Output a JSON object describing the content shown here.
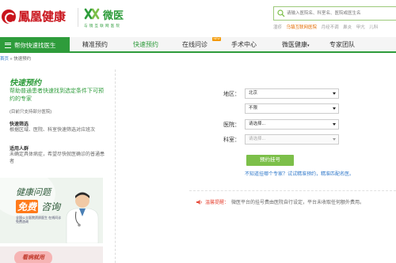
{
  "header": {
    "brand_fh": "鳳凰健康",
    "brand_wy": "微医",
    "brand_wy_sub": "与 镜 互 联 网 医 院",
    "search_placeholder": "请输入医院名、科室名、医院或医生名",
    "hot_items": [
      {
        "text": "湿疹",
        "hl": false
      },
      {
        "text": "乌镇互联网医院",
        "hl": true
      },
      {
        "text": "月经不调",
        "hl": false
      },
      {
        "text": "鼻炎",
        "hl": false
      },
      {
        "text": "甲亢",
        "hl": false
      },
      {
        "text": "儿科",
        "hl": false
      }
    ]
  },
  "nav": {
    "primary": "帮你快速找医生",
    "items": [
      "精准预约",
      "快速预约",
      "在线问诊",
      "手术中心",
      "微医健康",
      "专家团队"
    ],
    "active_index": 1,
    "new_badge": "NEW",
    "dropdown_caret": "▾"
  },
  "breadcrumb": {
    "home": "首页",
    "sep": " » ",
    "current": "快速预约"
  },
  "sidebar": {
    "title": "快速预约",
    "subtitle": "帮助普通患者快速找到选定条件下可预约的专家",
    "note": "(目前只支持部分医院)",
    "sections": [
      {
        "heading": "快速筛选",
        "text": "根据区域、医院、科室快速筛选对应班次"
      },
      {
        "heading": "适用人群",
        "text": "未确定具体病症，希望尽快就医确诊的普通患者"
      }
    ],
    "banner1": {
      "line1": "健康问题",
      "line2a": "免费",
      "line2b": "咨询",
      "fine": "全国公立医院资质医生 在线问诊免费咨询"
    },
    "banner2": {
      "text": "看病就用"
    }
  },
  "form": {
    "region_label": "地区：",
    "region_value": "北京",
    "district_value": "不限",
    "hospital_label": "医院：",
    "hospital_value": "请选择...",
    "dept_label": "科室：",
    "dept_value": "请选择...",
    "submit": "预约挂号",
    "help_link": "不知道挂哪个专家？试试精准预约，精准匹配名医。",
    "notice_label": "温馨提醒：",
    "notice_text": "微医平台的挂号费由医院自行设定，平台未收取任何额外费用。"
  }
}
